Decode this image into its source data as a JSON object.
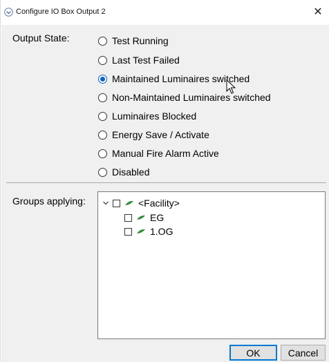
{
  "window": {
    "title": "Configure IO Box Output 2",
    "close_glyph": "✕"
  },
  "output_state": {
    "label": "Output State:",
    "selected_index": 2,
    "options": [
      "Test Running",
      "Last Test Failed",
      "Maintained Luminaires switched",
      "Non-Maintained Luminaires switched",
      "Luminaires Blocked",
      "Energy Save / Activate",
      "Manual Fire Alarm Active",
      "Disabled"
    ]
  },
  "groups": {
    "label": "Groups applying:",
    "root": {
      "label": "<Facility>",
      "expanded": true,
      "checked": false,
      "icon": "leaf-icon",
      "children": [
        {
          "label": "EG",
          "checked": false,
          "icon": "leaf-icon"
        },
        {
          "label": "1.OG",
          "checked": false,
          "icon": "leaf-icon"
        }
      ]
    }
  },
  "buttons": {
    "ok": "OK",
    "cancel": "Cancel"
  },
  "colors": {
    "accent": "#0a64c8",
    "leaf": "#2e8b3e",
    "dialog_background": "#f0f0f0"
  }
}
